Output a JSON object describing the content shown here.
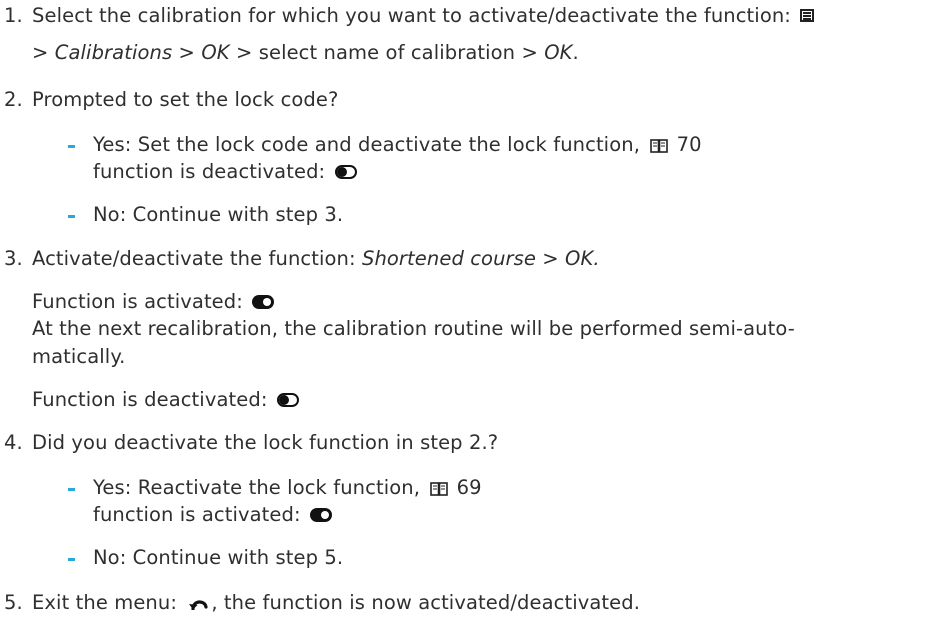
{
  "step1": {
    "num": "1.",
    "line1": "Select the calibration for which you want to activate/deactivate the function:",
    "line2_sep1": ">",
    "line2_calibrations": "Calibrations",
    "line2_sep2": ">",
    "line2_ok1": "OK",
    "line2_mid": "> select name of calibration >",
    "line2_ok2": "OK",
    "line2_end": "."
  },
  "step2": {
    "num": "2.",
    "text": "Prompted to set the lock code?",
    "yes_line1": "Yes: Set the lock code and deactivate the lock function,",
    "yes_ref": "70",
    "yes_line2": "function is deactivated:",
    "no": "No: Continue with step 3."
  },
  "step3": {
    "num": "3.",
    "text": "Activate/deactivate the function:",
    "action": "Shortened course > OK.",
    "activated": "Function is activated:",
    "note_line1": "At the next recalibration, the calibration routine will be performed semi-auto-",
    "note_line2": "matically.",
    "deactivated": "Function is deactivated:"
  },
  "step4": {
    "num": "4.",
    "text": "Did you deactivate the lock function in step 2.?",
    "yes_line1": "Yes: Reactivate the lock function,",
    "yes_ref": "69",
    "yes_line2": "function is activated:",
    "no": "No: Continue with step 5."
  },
  "step5": {
    "num": "5.",
    "text_before": "Exit the menu:",
    "text_after": ", the function is now activated/deactivated."
  },
  "colors": {
    "bullet": "#2aa7dc",
    "text": "#2f2f2f"
  },
  "icons": [
    "menu-icon",
    "book-icon",
    "toggle-off-icon",
    "toggle-on-icon",
    "back-arrow-icon"
  ]
}
